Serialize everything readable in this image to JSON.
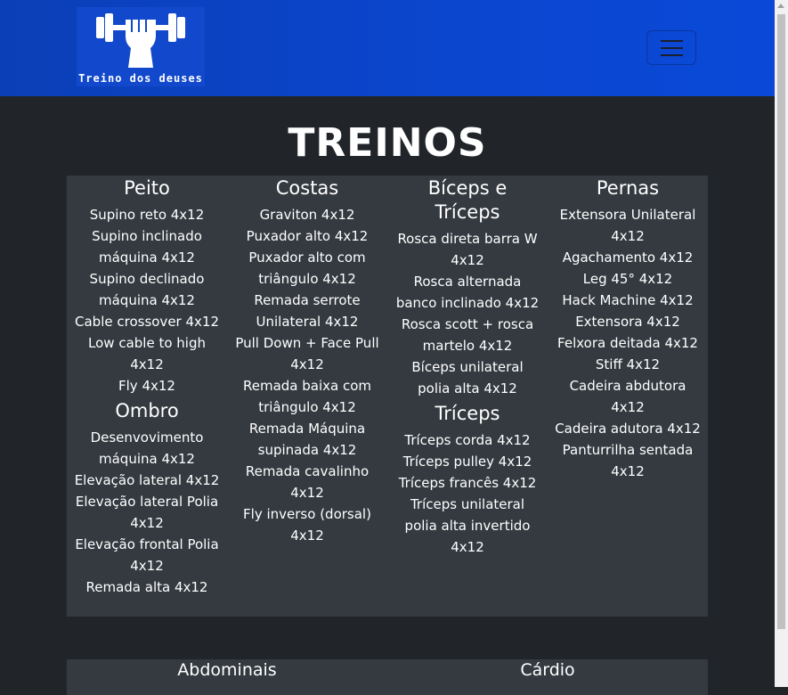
{
  "brand": {
    "logo_text": "Treino dos deuses"
  },
  "page": {
    "title": "TREINOS"
  },
  "columns": [
    {
      "groups": [
        {
          "title": "Peito",
          "items": [
            "Supino reto 4x12",
            "Supino inclinado máquina 4x12",
            "Supino declinado máquina 4x12",
            "Cable crossover 4x12",
            "Low cable to high 4x12",
            "Fly 4x12"
          ]
        },
        {
          "title": "Ombro",
          "items": [
            "Desenvovimento máquina 4x12",
            "Elevação lateral 4x12",
            "Elevação lateral Polia 4x12",
            "Elevação frontal Polia 4x12",
            "Remada alta 4x12"
          ]
        }
      ]
    },
    {
      "groups": [
        {
          "title": "Costas",
          "items": [
            "Graviton 4x12",
            "Puxador alto 4x12",
            "Puxador alto com triângulo 4x12",
            "Remada serrote Unilateral 4x12",
            "Pull Down + Face Pull 4x12",
            "Remada baixa com triângulo 4x12",
            "Remada Máquina supinada 4x12",
            "Remada cavalinho 4x12",
            "Fly inverso (dorsal) 4x12"
          ]
        }
      ]
    },
    {
      "groups": [
        {
          "title": "Bíceps e Tríceps",
          "items": [
            "Rosca direta barra W 4x12",
            "Rosca alternada banco inclinado 4x12",
            "Rosca scott + rosca martelo 4x12",
            "Bíceps unilateral polia alta 4x12"
          ]
        },
        {
          "title": "Tríceps",
          "items": [
            "Tríceps corda 4x12",
            "Tríceps pulley 4x12",
            "Tríceps francês 4x12",
            "Tríceps unilateral polia alta invertido 4x12"
          ]
        }
      ]
    },
    {
      "groups": [
        {
          "title": "Pernas",
          "items": [
            "Extensora Unilateral 4x12",
            "Agachamento 4x12",
            "Leg 45° 4x12",
            "Hack Machine 4x12",
            "Extensora 4x12",
            "Felxora deitada 4x12",
            "Stiff 4x12",
            "Cadeira abdutora 4x12",
            "Cadeira adutora 4x12",
            "Panturrilha sentada 4x12"
          ]
        }
      ]
    }
  ],
  "second_section": {
    "left_title": "Abdominais",
    "right_title": "Cárdio"
  },
  "colors": {
    "navbar": "#0b46cf",
    "background": "#212529",
    "panel": "#343a40"
  }
}
